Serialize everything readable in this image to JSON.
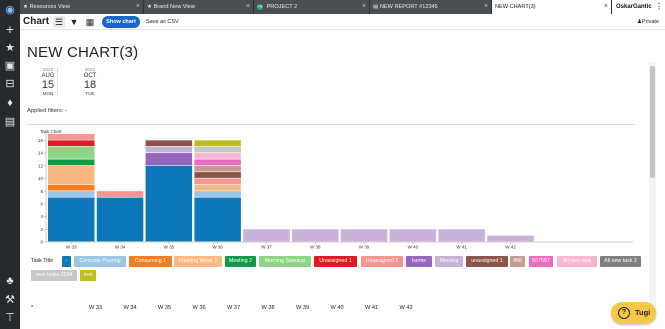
{
  "tabs": [
    {
      "label": "Resources View",
      "icon": "star-icon",
      "active": false
    },
    {
      "label": "Brand New View",
      "icon": "star-icon",
      "active": false
    },
    {
      "label": "PROJECT 2",
      "icon": "project-badge-icon",
      "badge": "PR",
      "active": false
    },
    {
      "label": "NEW REPORT #12345",
      "icon": "report-icon",
      "active": false
    },
    {
      "label": "NEW CHART(3)",
      "icon": "",
      "active": true
    }
  ],
  "user": {
    "name": "OskarGantic"
  },
  "toolbar": {
    "title": "Chart",
    "menu_icon": "hamburger-icon",
    "filter_icon": "filter-icon",
    "calendar_icon": "calendar-icon",
    "show_chart_label": "Show chart",
    "save_csv_label": "Save as CSV",
    "private_label": "Private"
  },
  "page_title": "NEW CHART(3)",
  "dates": {
    "start": {
      "year": "2022",
      "month": "AUG",
      "day": "15",
      "weekday": "MON"
    },
    "end": {
      "year": "2022",
      "month": "OCT",
      "day": "18",
      "weekday": "TUE"
    }
  },
  "applied_filters": "Applied filters: -",
  "chart_data": {
    "type": "bar",
    "stacked": true,
    "title": "Task Chart",
    "categories": [
      "W 33",
      "W 34",
      "W 35",
      "W 36",
      "W 37",
      "W 38",
      "W 39",
      "W 40",
      "W 41",
      "W 42"
    ],
    "ylim": [
      0,
      17
    ],
    "yticks": [
      0,
      2,
      4,
      6,
      8,
      10,
      12,
      14,
      16
    ],
    "series": [
      {
        "name": "-",
        "color": "#0d78b9",
        "values": [
          7,
          7,
          12,
          7,
          0,
          0,
          0,
          0,
          0,
          0
        ]
      },
      {
        "name": "Concrete Pouring",
        "color": "#9cc6e6",
        "values": [
          1,
          0,
          0,
          1,
          0,
          0,
          0,
          0,
          0,
          0
        ]
      },
      {
        "name": "Consuming 1",
        "color": "#f57f20",
        "values": [
          1,
          0,
          0,
          0,
          0,
          0,
          0,
          0,
          0,
          0
        ]
      },
      {
        "name": "Framing Week 1",
        "color": "#f9b981",
        "values": [
          3,
          0,
          0,
          1,
          0,
          0,
          0,
          0,
          0,
          0
        ]
      },
      {
        "name": "Meeting 2",
        "color": "#109a45",
        "values": [
          1,
          0,
          0,
          0,
          0,
          0,
          0,
          0,
          0,
          0
        ]
      },
      {
        "name": "Morning Standup",
        "color": "#8fd485",
        "values": [
          2,
          0,
          0,
          0,
          0,
          0,
          0,
          0,
          0,
          0
        ]
      },
      {
        "name": "Unassigned 1",
        "color": "#e11b24",
        "values": [
          1,
          0,
          0,
          0,
          0,
          0,
          0,
          0,
          0,
          0
        ]
      },
      {
        "name": "Unassigned 2",
        "color": "#f79591",
        "values": [
          1,
          1,
          0,
          1,
          0,
          0,
          0,
          0,
          0,
          0
        ]
      },
      {
        "name": "Iseme",
        "color": "#9466be",
        "values": [
          0,
          0,
          2,
          0,
          0,
          0,
          0,
          0,
          0,
          0
        ]
      },
      {
        "name": "Meeting",
        "color": "#c7b1d8",
        "values": [
          0,
          0,
          1,
          0,
          2,
          2,
          2,
          2,
          2,
          1
        ]
      },
      {
        "name": "unassigned 1",
        "color": "#8c5349",
        "values": [
          0,
          0,
          1,
          1,
          0,
          0,
          0,
          0,
          0,
          0
        ]
      },
      {
        "name": "456",
        "color": "#c69b94",
        "values": [
          0,
          0,
          0,
          1,
          0,
          0,
          0,
          0,
          0,
          0
        ]
      },
      {
        "name": "567567",
        "color": "#ea6bbf",
        "values": [
          0,
          0,
          0,
          1,
          0,
          0,
          0,
          0,
          0,
          0
        ]
      },
      {
        "name": "All new task",
        "color": "#f6b6d2",
        "values": [
          0,
          0,
          0,
          1,
          0,
          0,
          0,
          0,
          0,
          0
        ]
      },
      {
        "name": "All new task 2",
        "color": "#7f7f7f",
        "values": [
          0,
          0,
          0,
          0,
          0,
          0,
          0,
          0,
          0,
          0
        ]
      },
      {
        "name": "new tasks 3234",
        "color": "#c7c7c7",
        "values": [
          0,
          0,
          0,
          1,
          0,
          0,
          0,
          0,
          0,
          0
        ]
      },
      {
        "name": "test",
        "color": "#bcbd22",
        "values": [
          0,
          0,
          0,
          1,
          0,
          0,
          0,
          0,
          0,
          0
        ]
      }
    ]
  },
  "legend_title": "Task Title",
  "table": {
    "first_col": "*",
    "columns": [
      "W 33",
      "W 34",
      "W 35",
      "W 36",
      "W 37",
      "W 38",
      "W 39",
      "W 40",
      "W 41",
      "W 42"
    ]
  },
  "help_label": "Tugi"
}
